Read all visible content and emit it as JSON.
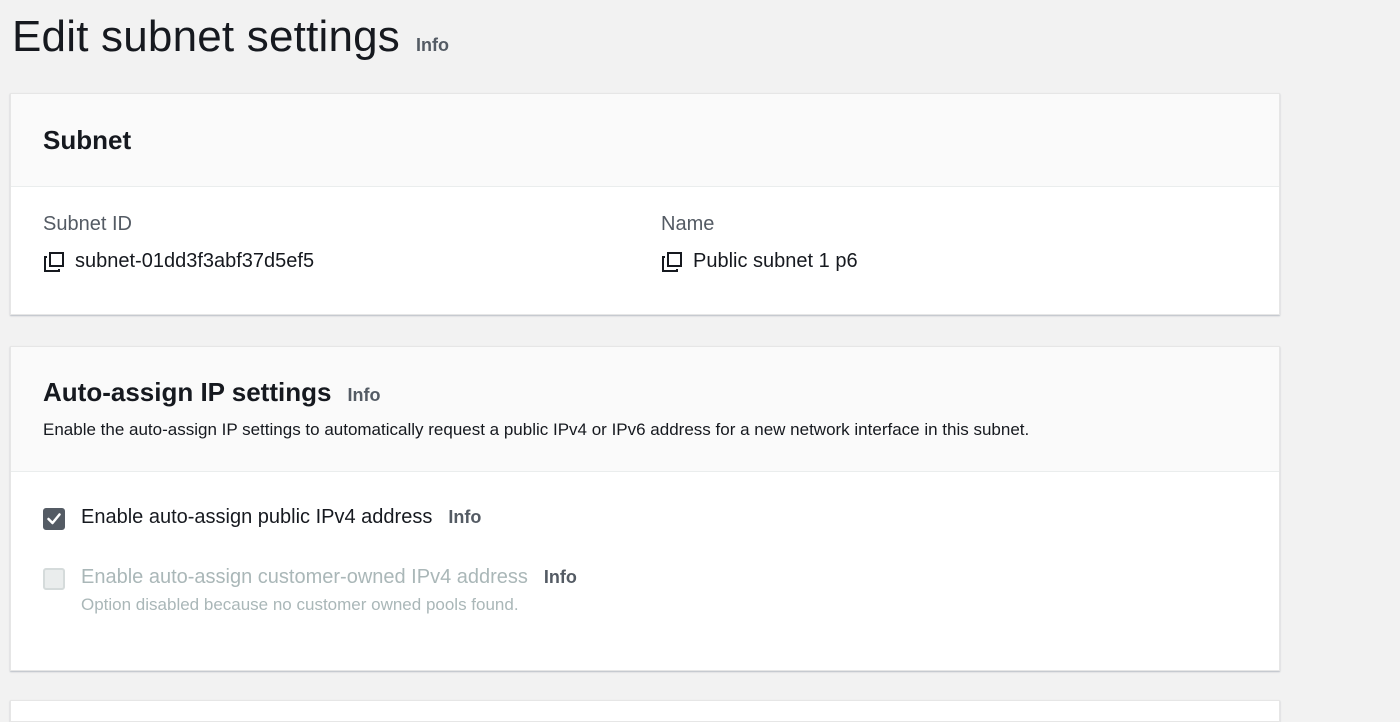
{
  "page": {
    "title": "Edit subnet settings",
    "info_label": "Info"
  },
  "subnet_panel": {
    "title": "Subnet",
    "subnet_id": {
      "label": "Subnet ID",
      "value": "subnet-01dd3f3abf37d5ef5",
      "icon": "copy-icon"
    },
    "name": {
      "label": "Name",
      "value": "Public subnet 1 p6",
      "icon": "copy-icon"
    }
  },
  "auto_assign_panel": {
    "title": "Auto-assign IP settings",
    "info_label": "Info",
    "description": "Enable the auto-assign IP settings to automatically request a public IPv4 or IPv6 address for a new network interface in this subnet.",
    "options": [
      {
        "label": "Enable auto-assign public IPv4 address",
        "info_label": "Info",
        "checked": true,
        "disabled": false
      },
      {
        "label": "Enable auto-assign customer-owned IPv4 address",
        "info_label": "Info",
        "checked": false,
        "disabled": true,
        "note": "Option disabled because no customer owned pools found."
      }
    ]
  },
  "colors": {
    "background": "#f2f2f2",
    "panel": "#ffffff",
    "panel_header": "#fafafa",
    "text": "#16191f",
    "muted_text": "#545b64",
    "disabled_text": "#aab7b8",
    "checkbox_checked": "#545b64"
  }
}
